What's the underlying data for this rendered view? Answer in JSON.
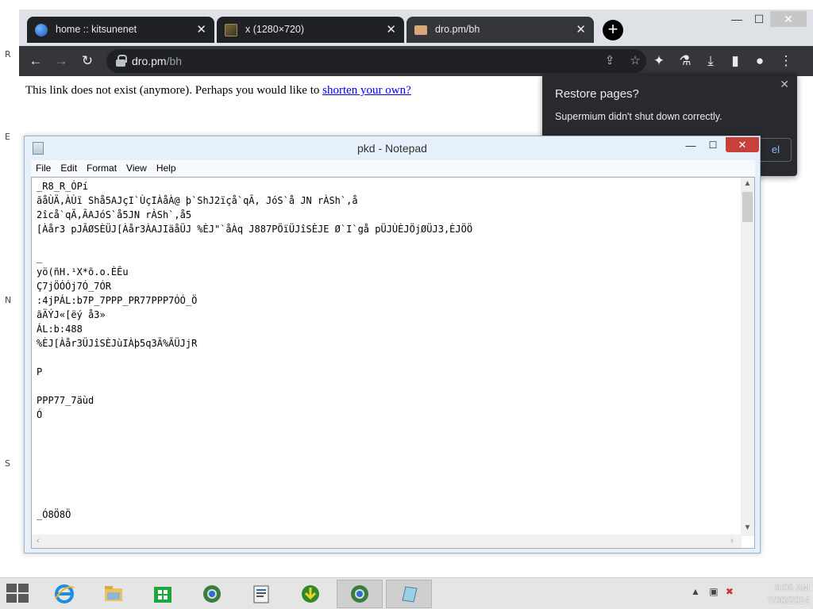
{
  "browser": {
    "tabs": [
      {
        "title": "home :: kitsunenet",
        "icon": "globe-icon"
      },
      {
        "title": "x (1280×720)",
        "icon": "image-icon"
      },
      {
        "title": "dro.pm/bh",
        "icon": "page-icon",
        "active": true
      }
    ],
    "new_tab_label": "+",
    "url_domain": "dro.pm",
    "url_path": "/bh",
    "page": {
      "message": "This link does not exist (anymore). Perhaps you would like to ",
      "link_text": "shorten your own?"
    },
    "restore_popup": {
      "title": "Restore pages?",
      "text": "Supermium didn't shut down correctly.",
      "button": "el"
    }
  },
  "notepad": {
    "title": "pkd - Notepad",
    "menu": [
      "File",
      "Edit",
      "Format",
      "View",
      "Help"
    ],
    "content": "_R8_R_ÓPí\nãåÙÄ,ÀÙï Shå5AJçI`ÙçIÀåÀ@ þ`ShJ2ïçå`qÃ, JóS`å JN rÀSh`,å\n2îcå`qÃ,ÃAJóS`å5JN rÀSh`,å5\n[Àår3 pJÃØSÈÜJ[Àår3ÀAJIäåÜJ %ÈJ\"`åÀq J887PÖïÜJîSÈJE Ø`I`gå pÜJÙÈJÖjØÜJ3,ÈJÖÖ\n\n_\nyö(ñH.¹X*õ.o.ÈÊu\nÇ7jÖÓÓj7Ó_7ÓR\n:4jPÁL:b7P_7PPP_PR77PPP7ÓÓ_Ö\nãÄÝJ«[ëý å3»\nÁL:b:488\n%ÈJ[Àår3ÜJîSÈJùIÀþ5q3Ã%ÃÜJjR\n\nP\n\nPPP77_7äùd\nÓ\n\n\n\n\n\n\n_Ó8Ö8Ö"
  },
  "taskbar": {
    "apps": [
      "ie-icon",
      "explorer-icon",
      "store-icon",
      "chrome-icon",
      "notepad-icon",
      "download-icon",
      "chrome-icon",
      "notepad-icon"
    ],
    "time": "6:05 AM",
    "date": "7/30/2024"
  },
  "colors": {
    "tab_strip": "#dee1e6",
    "toolbar": "#35363a",
    "link": "#0000ee",
    "notepad_close": "#c7403a"
  }
}
